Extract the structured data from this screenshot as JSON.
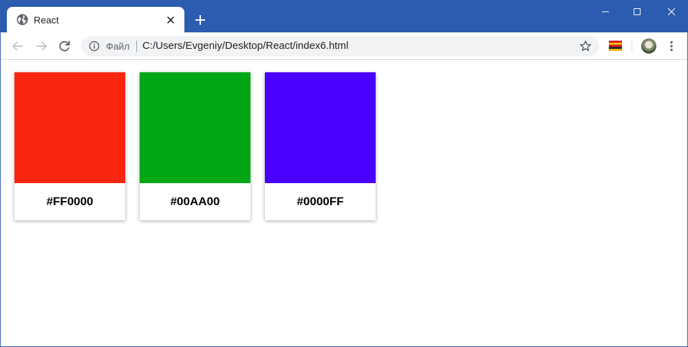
{
  "tab": {
    "title": "React",
    "icon": "globe-icon"
  },
  "toolbar": {
    "scheme_label": "Файл",
    "url": "C:/Users/Evgeniy/Desktop/React/index6.html"
  },
  "colors": {
    "titlebar": "#2b5cb0",
    "omnibox_bg": "#f1f3f4"
  },
  "cards": [
    {
      "label": "#FF0000",
      "swatch_color": "#f8250f"
    },
    {
      "label": "#00AA00",
      "swatch_color": "#01a715"
    },
    {
      "label": "#0000FF",
      "swatch_color": "#4801ff"
    }
  ]
}
